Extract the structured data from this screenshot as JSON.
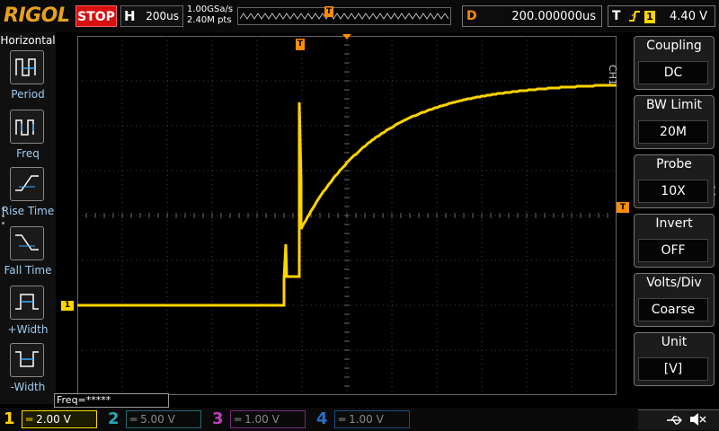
{
  "top": {
    "brand": "RIGOL",
    "run_state": "STOP",
    "timebase_label": "H",
    "timebase_value": "200us",
    "sample_rate": "1.00GSa/s",
    "memory_depth": "2.40M pts",
    "trigger_marker": "T",
    "delay_label": "D",
    "delay_value": "200.000000us",
    "trigger_label": "T",
    "trigger_edge": "rising-edge-icon",
    "trigger_source": "1",
    "trigger_level": "4.40 V"
  },
  "left": {
    "title": "Horizontal",
    "items": [
      {
        "label": "Period",
        "icon": "period-icon"
      },
      {
        "label": "Freq",
        "icon": "freq-icon"
      },
      {
        "label": "Rise Time",
        "icon": "rise-time-icon"
      },
      {
        "label": "Fall Time",
        "icon": "fall-time-icon"
      },
      {
        "label": "+Width",
        "icon": "plus-width-icon"
      },
      {
        "label": "-Width",
        "icon": "minus-width-icon"
      }
    ]
  },
  "right": {
    "channel_label": "CH1",
    "items": [
      {
        "title": "Coupling",
        "value": "DC"
      },
      {
        "title": "BW Limit",
        "value": "20M"
      },
      {
        "title": "Probe",
        "value": "10X"
      },
      {
        "title": "Invert",
        "value": "OFF"
      },
      {
        "title": "Volts/Div",
        "value": "Coarse"
      },
      {
        "title": "Unit",
        "value": "[V]"
      }
    ]
  },
  "measure": {
    "freq": "Freq=*****"
  },
  "channels": [
    {
      "num": "1",
      "scale": "2.00 V",
      "color": "#ffd400"
    },
    {
      "num": "2",
      "scale": "5.00 V",
      "color": "#2aa8b8"
    },
    {
      "num": "3",
      "scale": "1.00 V",
      "color": "#c040c0"
    },
    {
      "num": "4",
      "scale": "1.00 V",
      "color": "#2a70c8"
    }
  ],
  "markers": {
    "ch1_ground": "1",
    "trigger_pos": "T",
    "trigger_level": "T"
  },
  "colors": {
    "ch1": "#ffd400",
    "trigger": "#ff8c00",
    "accent": "#3ab0ff",
    "stop": "#d81010"
  }
}
